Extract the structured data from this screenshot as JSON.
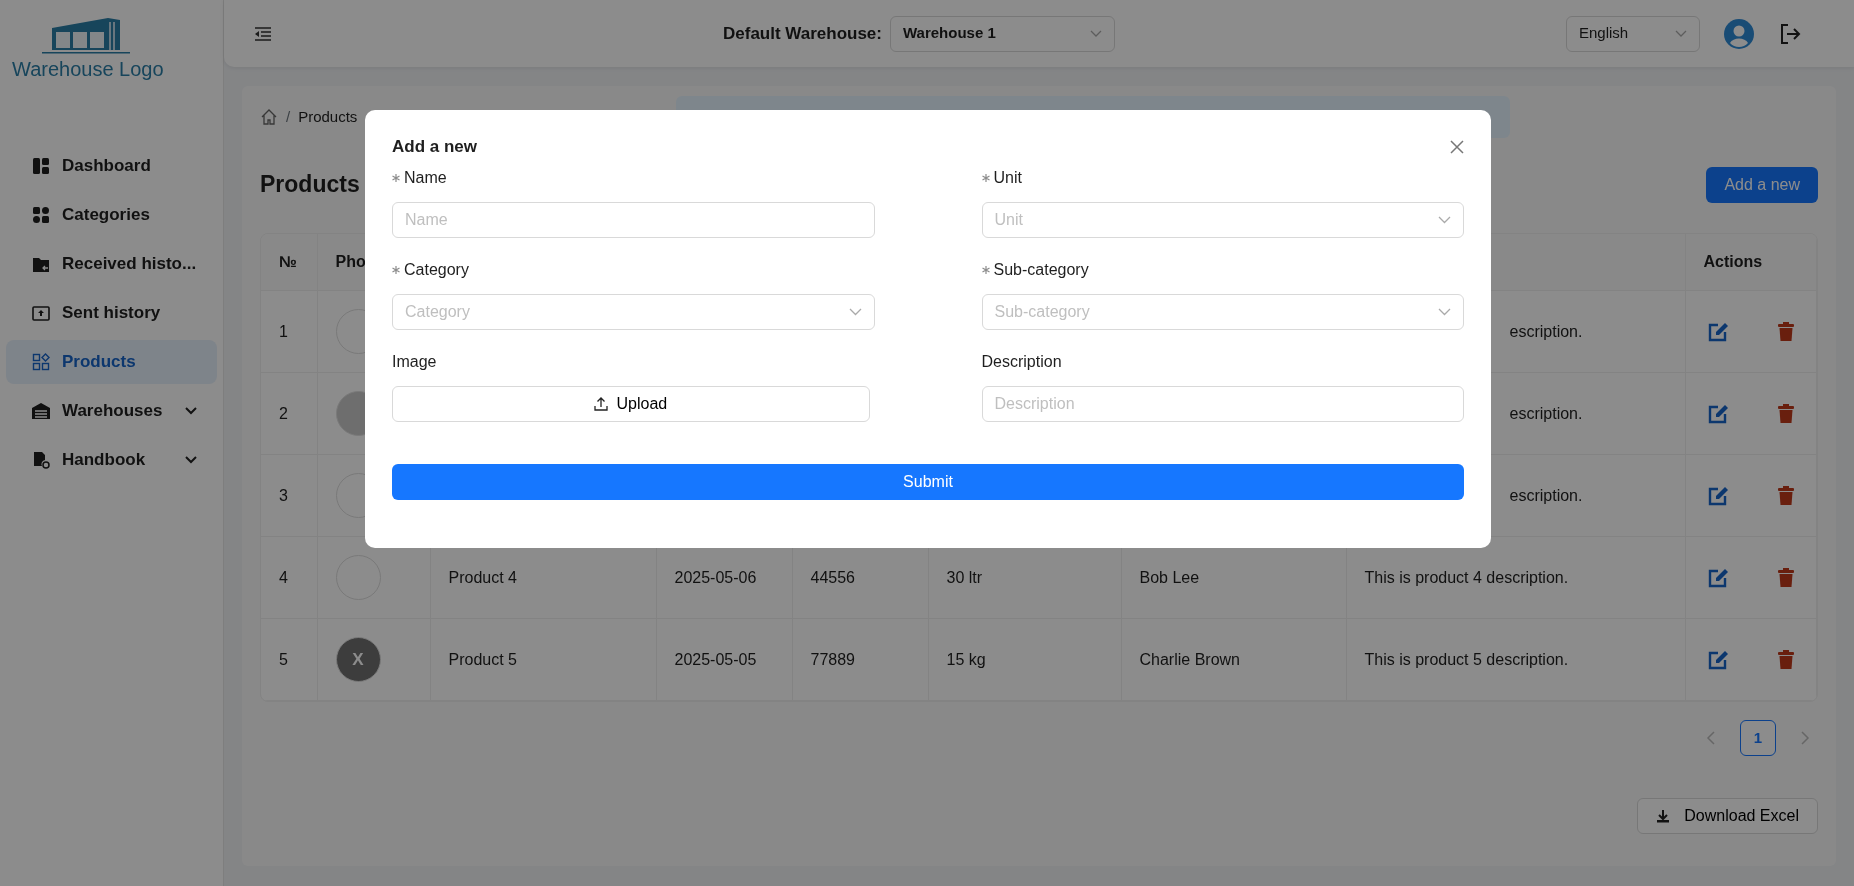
{
  "sidebar": {
    "logo_text": "Warehouse Logo",
    "items": [
      {
        "label": "Dashboard",
        "selected": false,
        "has_submenu": false
      },
      {
        "label": "Categories",
        "selected": false,
        "has_submenu": false
      },
      {
        "label": "Received histo...",
        "selected": false,
        "has_submenu": false
      },
      {
        "label": "Sent history",
        "selected": false,
        "has_submenu": false
      },
      {
        "label": "Products",
        "selected": true,
        "has_submenu": false
      },
      {
        "label": "Warehouses",
        "selected": false,
        "has_submenu": true
      },
      {
        "label": "Handbook",
        "selected": false,
        "has_submenu": true
      }
    ]
  },
  "topbar": {
    "warehouse_label": "Default Warehouse:",
    "warehouse_value": "Warehouse 1",
    "language": "English"
  },
  "breadcrumb": {
    "separator": "/",
    "items": [
      "Products"
    ]
  },
  "page_title": "Products",
  "add_button": "Add a new",
  "table": {
    "columns": [
      "№",
      "Pho",
      "Actions"
    ],
    "rows": [
      {
        "number": "1",
        "kind": "empty",
        "description": "escription."
      },
      {
        "number": "2",
        "kind": "image",
        "description": "escription."
      },
      {
        "number": "3",
        "kind": "empty",
        "description": "escription."
      },
      {
        "number": "4",
        "kind": "empty",
        "name": "Product 4",
        "date": "2025-05-06",
        "code": "44556",
        "quantity": "30 ltr",
        "person": "Bob Lee",
        "description": "This is product 4 description."
      },
      {
        "number": "5",
        "kind": "letter",
        "photo_letter": "X",
        "name": "Product 5",
        "date": "2025-05-05",
        "code": "77889",
        "quantity": "15 kg",
        "person": "Charlie Brown",
        "description": "This is product 5 description."
      }
    ]
  },
  "pagination": {
    "pages": [
      {
        "label": "1",
        "selected": true
      }
    ]
  },
  "download_button": "Download Excel",
  "modal": {
    "title": "Add a new",
    "fields": [
      {
        "kind": "input",
        "label": "Name",
        "required": true,
        "placeholder": "Name"
      },
      {
        "kind": "select",
        "label": "Unit",
        "required": true,
        "placeholder": "Unit"
      },
      {
        "kind": "select",
        "label": "Category",
        "required": true,
        "placeholder": "Category"
      },
      {
        "kind": "select",
        "label": "Sub-category",
        "required": true,
        "placeholder": "Sub-category"
      },
      {
        "kind": "upload",
        "label": "Image",
        "required": false,
        "button": "Upload"
      },
      {
        "kind": "input",
        "label": "Description",
        "required": false,
        "placeholder": "Description"
      }
    ],
    "submit": "Submit"
  }
}
